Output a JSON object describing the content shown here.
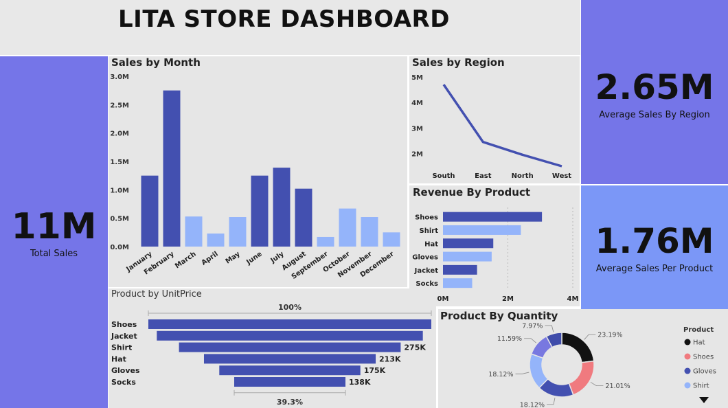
{
  "header": {
    "title": "LITA STORE DASHBOARD"
  },
  "kpis": {
    "total_sales": {
      "value": "11M",
      "label": "Total Sales"
    },
    "avg_region": {
      "value": "2.65M",
      "label": "Average Sales By Region"
    },
    "avg_product": {
      "value": "1.76M",
      "label": "Average Sales Per Product"
    }
  },
  "colors": {
    "dark": "#4350b0",
    "light": "#94b4fa",
    "purple_panel": "#7575e8",
    "blue_panel": "#7b97f7",
    "hat": "#111111",
    "shoes": "#f07a7f",
    "gloves": "#4350b0",
    "shirt": "#94b4fa"
  },
  "chart_data": [
    {
      "type": "bar",
      "title": "Sales by Month",
      "categories": [
        "January",
        "February",
        "March",
        "April",
        "May",
        "June",
        "July",
        "August",
        "September",
        "October",
        "November",
        "December"
      ],
      "values": [
        1.25,
        2.75,
        0.53,
        0.23,
        0.52,
        1.25,
        1.39,
        1.02,
        0.17,
        0.67,
        0.52,
        0.25
      ],
      "value_units": "M",
      "highlight": [
        true,
        true,
        false,
        false,
        false,
        true,
        true,
        true,
        false,
        false,
        false,
        false
      ],
      "yticks": [
        "0.0M",
        "0.5M",
        "1.0M",
        "1.5M",
        "2.0M",
        "2.5M",
        "3.0M"
      ],
      "ylim": [
        0,
        3.0
      ],
      "grid": false
    },
    {
      "type": "line",
      "title": "Sales by Region",
      "x": [
        "South",
        "East",
        "North",
        "West"
      ],
      "values": [
        4.7,
        2.45,
        1.95,
        1.5
      ],
      "value_units": "M",
      "yticks": [
        "2M",
        "3M",
        "4M",
        "5M"
      ],
      "ylim": [
        1.5,
        5.0
      ]
    },
    {
      "type": "bar",
      "orientation": "horizontal",
      "title": "Revenue By Product",
      "categories": [
        "Shoes",
        "Shirt",
        "Hat",
        "Gloves",
        "Jacket",
        "Socks"
      ],
      "values": [
        3.05,
        2.4,
        1.55,
        1.5,
        1.05,
        0.9
      ],
      "value_units": "M",
      "highlight": [
        true,
        false,
        true,
        false,
        true,
        false
      ],
      "xticks": [
        "0M",
        "2M",
        "4M"
      ],
      "xlim": [
        0,
        4
      ]
    },
    {
      "type": "bar",
      "orientation": "funnel",
      "title": "Product by UnitPrice",
      "categories": [
        "Shoes",
        "Jacket",
        "Shirt",
        "Hat",
        "Gloves",
        "Socks"
      ],
      "values": [
        351,
        330,
        275,
        213,
        175,
        138
      ],
      "value_units": "K",
      "data_labels": [
        "",
        "",
        "275K",
        "213K",
        "175K",
        "138K"
      ],
      "top_label": "100%",
      "bottom_label": "39.3%"
    },
    {
      "type": "pie",
      "style": "donut",
      "title": "Product By Quantity",
      "legend_title": "Product",
      "legend_placement": "right",
      "slices": [
        {
          "name": "Hat",
          "percent": 23.19,
          "label": "23.19%",
          "color": "#111111"
        },
        {
          "name": "Shoes",
          "percent": 21.01,
          "label": "21.01%",
          "color": "#f07a7f"
        },
        {
          "name": "Gloves",
          "percent": 18.12,
          "label": "18.12%",
          "color": "#4350b0"
        },
        {
          "name": "Shirt",
          "percent": 18.12,
          "label": "18.12%",
          "color": "#94b4fa"
        },
        {
          "name": "",
          "percent": 11.59,
          "label": "11.59%",
          "color": "#7878e0"
        },
        {
          "name": "",
          "percent": 7.97,
          "label": "7.97%",
          "color": "#3f4caa"
        }
      ],
      "legend": [
        "Hat",
        "Shoes",
        "Gloves",
        "Shirt"
      ]
    }
  ]
}
